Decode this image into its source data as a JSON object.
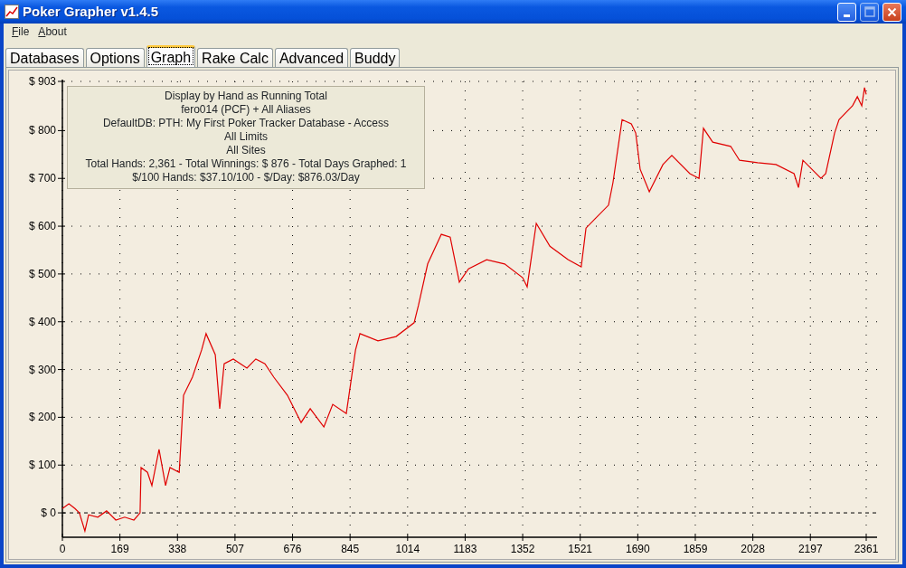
{
  "window": {
    "title": "Poker Grapher v1.4.5"
  },
  "menu": [
    "File",
    "About"
  ],
  "tabs": [
    {
      "label": "Databases",
      "selected": false
    },
    {
      "label": "Options",
      "selected": false
    },
    {
      "label": "Graph",
      "selected": true
    },
    {
      "label": "Rake Calc",
      "selected": false
    },
    {
      "label": "Advanced",
      "selected": false
    },
    {
      "label": "Buddy",
      "selected": false
    }
  ],
  "graph": {
    "info_box": [
      "Display by Hand as Running Total",
      "fero014 (PCF) + All Aliases",
      "DefaultDB: PTH: My First Poker Tracker Database - Access",
      "All Limits",
      "All Sites",
      "Total Hands: 2,361 - Total Winnings: $ 876 - Total Days Graphed: 1",
      "$/100 Hands: $37.10/100 - $/Day: $876.03/Day"
    ],
    "chart_data": {
      "type": "line",
      "x": [
        0,
        19,
        37,
        50,
        66,
        77,
        104,
        130,
        157,
        183,
        210,
        228,
        231,
        250,
        263,
        284,
        303,
        316,
        343,
        356,
        382,
        409,
        422,
        449,
        462,
        475,
        502,
        542,
        568,
        595,
        621,
        661,
        701,
        728,
        768,
        794,
        834,
        861,
        874,
        927,
        980,
        1033,
        1046,
        1073,
        1113,
        1139,
        1166,
        1193,
        1246,
        1299,
        1352,
        1365,
        1392,
        1432,
        1485,
        1524,
        1538,
        1564,
        1604,
        1617,
        1644,
        1671,
        1684,
        1697,
        1724,
        1764,
        1790,
        1843,
        1870,
        1883,
        1910,
        1963,
        1989,
        2042,
        2096,
        2149,
        2162,
        2175,
        2228,
        2242,
        2268,
        2281,
        2321,
        2335,
        2348,
        2356,
        2361
      ],
      "series": [
        {
          "color": "#e00000",
          "values": [
            9,
            19,
            9,
            0,
            -38,
            -4,
            -9,
            4,
            -15,
            -9,
            -15,
            0,
            95,
            85,
            57,
            133,
            57,
            95,
            85,
            246,
            284,
            341,
            375,
            331,
            218,
            312,
            322,
            303,
            322,
            312,
            284,
            246,
            189,
            218,
            180,
            227,
            208,
            341,
            375,
            360,
            369,
            398,
            435,
            521,
            583,
            577,
            483,
            511,
            530,
            521,
            492,
            473,
            606,
            558,
            530,
            515,
            596,
            615,
            644,
            691,
            823,
            814,
            795,
            719,
            672,
            729,
            748,
            710,
            700,
            805,
            776,
            767,
            738,
            733,
            729,
            710,
            681,
            738,
            700,
            710,
            795,
            823,
            852,
            871,
            852,
            890,
            876
          ]
        }
      ],
      "grid": true,
      "xlim": [
        0,
        2361
      ],
      "ylim": [
        -51,
        903
      ],
      "xticks": [
        0,
        169,
        338,
        507,
        676,
        845,
        1014,
        1183,
        1352,
        1521,
        1690,
        1859,
        2028,
        2197,
        2361
      ],
      "yticks": [
        {
          "value": 0,
          "label": "$ 0"
        },
        {
          "value": 100,
          "label": "$ 100"
        },
        {
          "value": 200,
          "label": "$ 200"
        },
        {
          "value": 300,
          "label": "$ 300"
        },
        {
          "value": 400,
          "label": "$ 400"
        },
        {
          "value": 500,
          "label": "$ 500"
        },
        {
          "value": 600,
          "label": "$ 600"
        },
        {
          "value": 700,
          "label": "$ 700"
        },
        {
          "value": 800,
          "label": "$ 800"
        },
        {
          "value": 903,
          "label": "$ 903"
        }
      ]
    }
  }
}
